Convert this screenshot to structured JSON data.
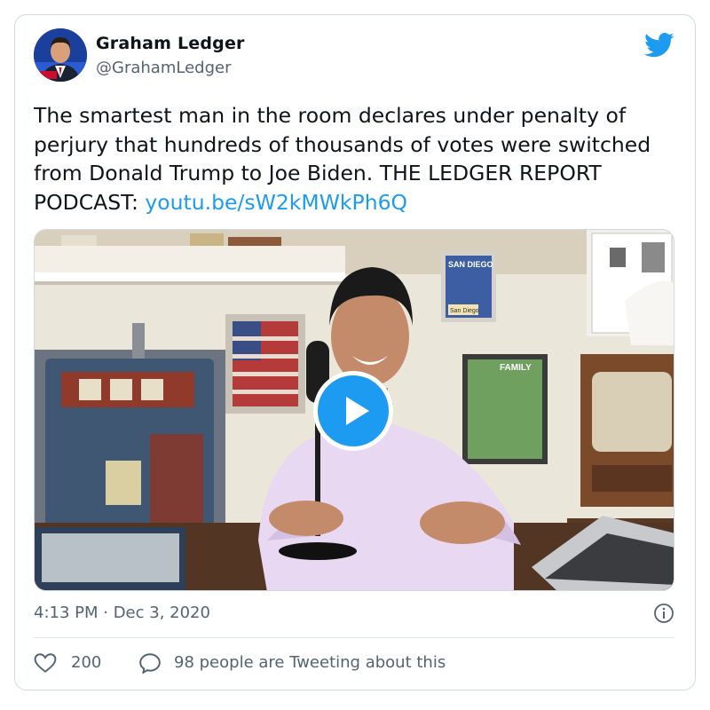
{
  "author": {
    "display_name": "Graham Ledger",
    "handle": "@GrahamLedger",
    "avatar_icon": "profile-photo-man-in-suit"
  },
  "tweet": {
    "text": "The smartest man in the room declares under penalty of perjury that hundreds of thousands of votes were switched from Donald Trump to Joe Biden. THE LEDGER REPORT PODCAST: ",
    "link_text": "youtu.be/sW2kMWkPh6Q",
    "media": {
      "type": "video",
      "play_icon": "play-icon",
      "poster_caption": "SAN DIEGO",
      "poster_footer": "San Diego",
      "frame_caption": "FAMILY"
    }
  },
  "meta": {
    "timestamp": "4:13 PM · Dec 3, 2020",
    "info_icon": "info-icon"
  },
  "actions": {
    "like_count": "200",
    "reply_text": "98 people are Tweeting about this"
  },
  "colors": {
    "accent": "#1d9bf0",
    "text_primary": "#0f1419",
    "text_secondary": "#536471",
    "border": "#cfd9de"
  }
}
